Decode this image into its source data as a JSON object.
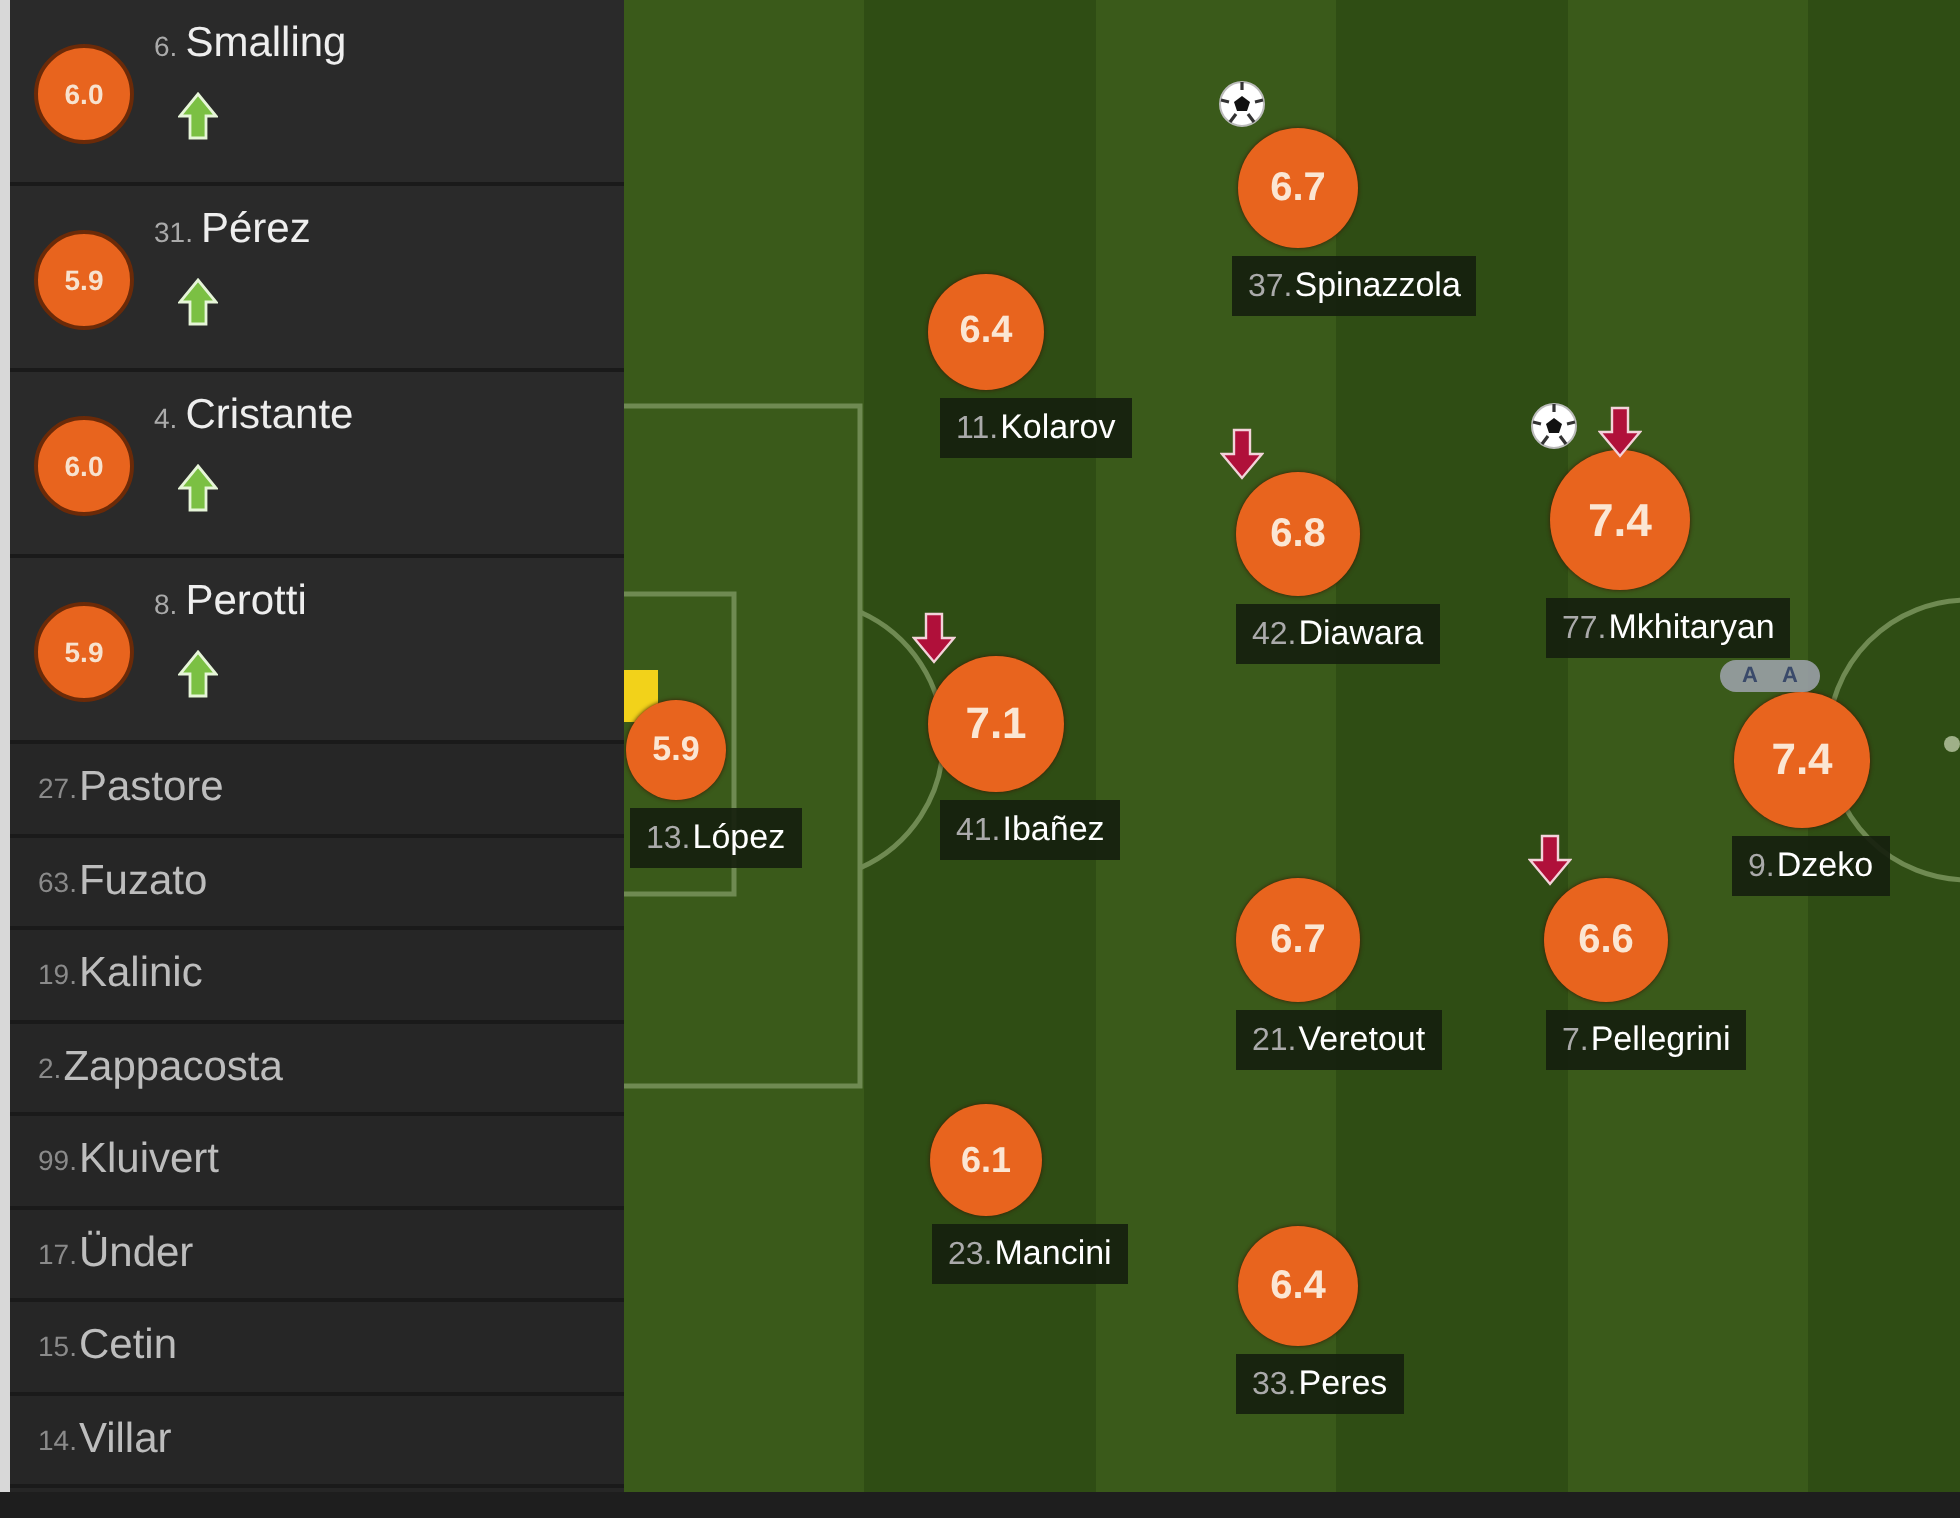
{
  "substitutes": [
    {
      "number": "6.",
      "name": "Smalling",
      "rating": "6.0",
      "subbed_on": true
    },
    {
      "number": "31.",
      "name": "Pérez",
      "rating": "5.9",
      "subbed_on": true
    },
    {
      "number": "4.",
      "name": "Cristante",
      "rating": "6.0",
      "subbed_on": true
    },
    {
      "number": "8.",
      "name": "Perotti",
      "rating": "5.9",
      "subbed_on": true
    }
  ],
  "bench": [
    {
      "number": "27.",
      "name": "Pastore"
    },
    {
      "number": "63.",
      "name": "Fuzato"
    },
    {
      "number": "19.",
      "name": "Kalinic"
    },
    {
      "number": "2.",
      "name": "Zappacosta"
    },
    {
      "number": "99.",
      "name": "Kluivert"
    },
    {
      "number": "17.",
      "name": "Ünder"
    },
    {
      "number": "15.",
      "name": "Cetin"
    },
    {
      "number": "14.",
      "name": "Villar"
    }
  ],
  "pitch": {
    "players": [
      {
        "number": "13.",
        "name": "López",
        "rating": "5.9",
        "goal": false,
        "subbed_off": false,
        "yellow_card": true
      },
      {
        "number": "11.",
        "name": "Kolarov",
        "rating": "6.4",
        "goal": false,
        "subbed_off": false,
        "yellow_card": false
      },
      {
        "number": "41.",
        "name": "Ibañez",
        "rating": "7.1",
        "goal": false,
        "subbed_off": true,
        "yellow_card": false
      },
      {
        "number": "23.",
        "name": "Mancini",
        "rating": "6.1",
        "goal": false,
        "subbed_off": false,
        "yellow_card": false
      },
      {
        "number": "37.",
        "name": "Spinazzola",
        "rating": "6.7",
        "goal": true,
        "subbed_off": false,
        "yellow_card": false
      },
      {
        "number": "42.",
        "name": "Diawara",
        "rating": "6.8",
        "goal": false,
        "subbed_off": true,
        "yellow_card": false
      },
      {
        "number": "21.",
        "name": "Veretout",
        "rating": "6.7",
        "goal": false,
        "subbed_off": false,
        "yellow_card": false
      },
      {
        "number": "33.",
        "name": "Peres",
        "rating": "6.4",
        "goal": false,
        "subbed_off": false,
        "yellow_card": false
      },
      {
        "number": "77.",
        "name": "Mkhitaryan",
        "rating": "7.4",
        "goal": true,
        "subbed_off": true,
        "yellow_card": false
      },
      {
        "number": "7.",
        "name": "Pellegrini",
        "rating": "6.6",
        "goal": false,
        "subbed_off": true,
        "yellow_card": false
      },
      {
        "number": "9.",
        "name": "Dzeko",
        "rating": "7.4",
        "goal": false,
        "subbed_off": false,
        "yellow_card": false,
        "assists": [
          "A",
          "A"
        ]
      }
    ]
  }
}
